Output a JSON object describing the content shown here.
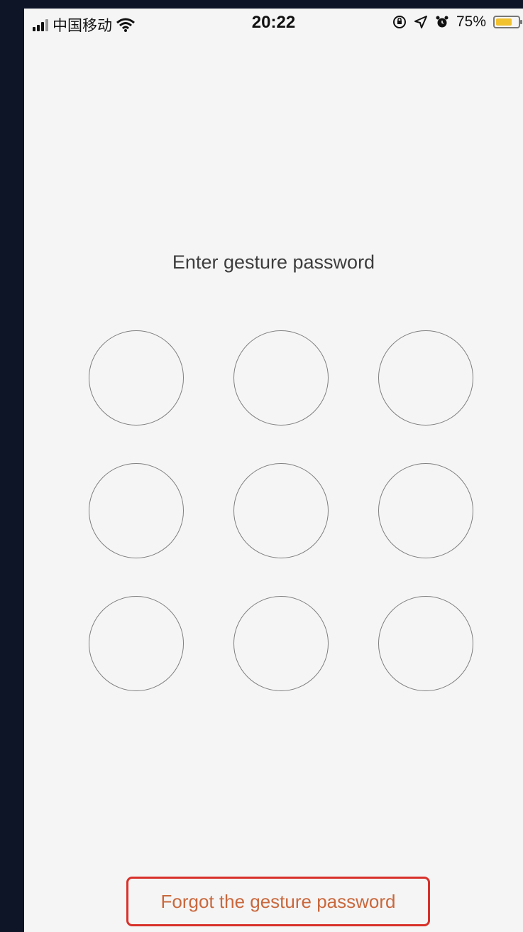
{
  "status_bar": {
    "carrier": "中国移动",
    "time": "20:22",
    "battery_percent_text": "75%",
    "battery_level": 0.75,
    "icons": [
      "signal-icon",
      "wifi-icon",
      "rotation-lock-icon",
      "location-icon",
      "alarm-icon",
      "battery-icon"
    ]
  },
  "main": {
    "prompt": "Enter gesture password",
    "pattern_points": 9
  },
  "footer": {
    "forgot_label": "Forgot the gesture password"
  },
  "colors": {
    "background": "#f5f5f5",
    "circle_border": "#7f7f7f",
    "forgot_text": "#c9683d",
    "forgot_border": "#d8312a",
    "battery": "#f2c12e"
  }
}
